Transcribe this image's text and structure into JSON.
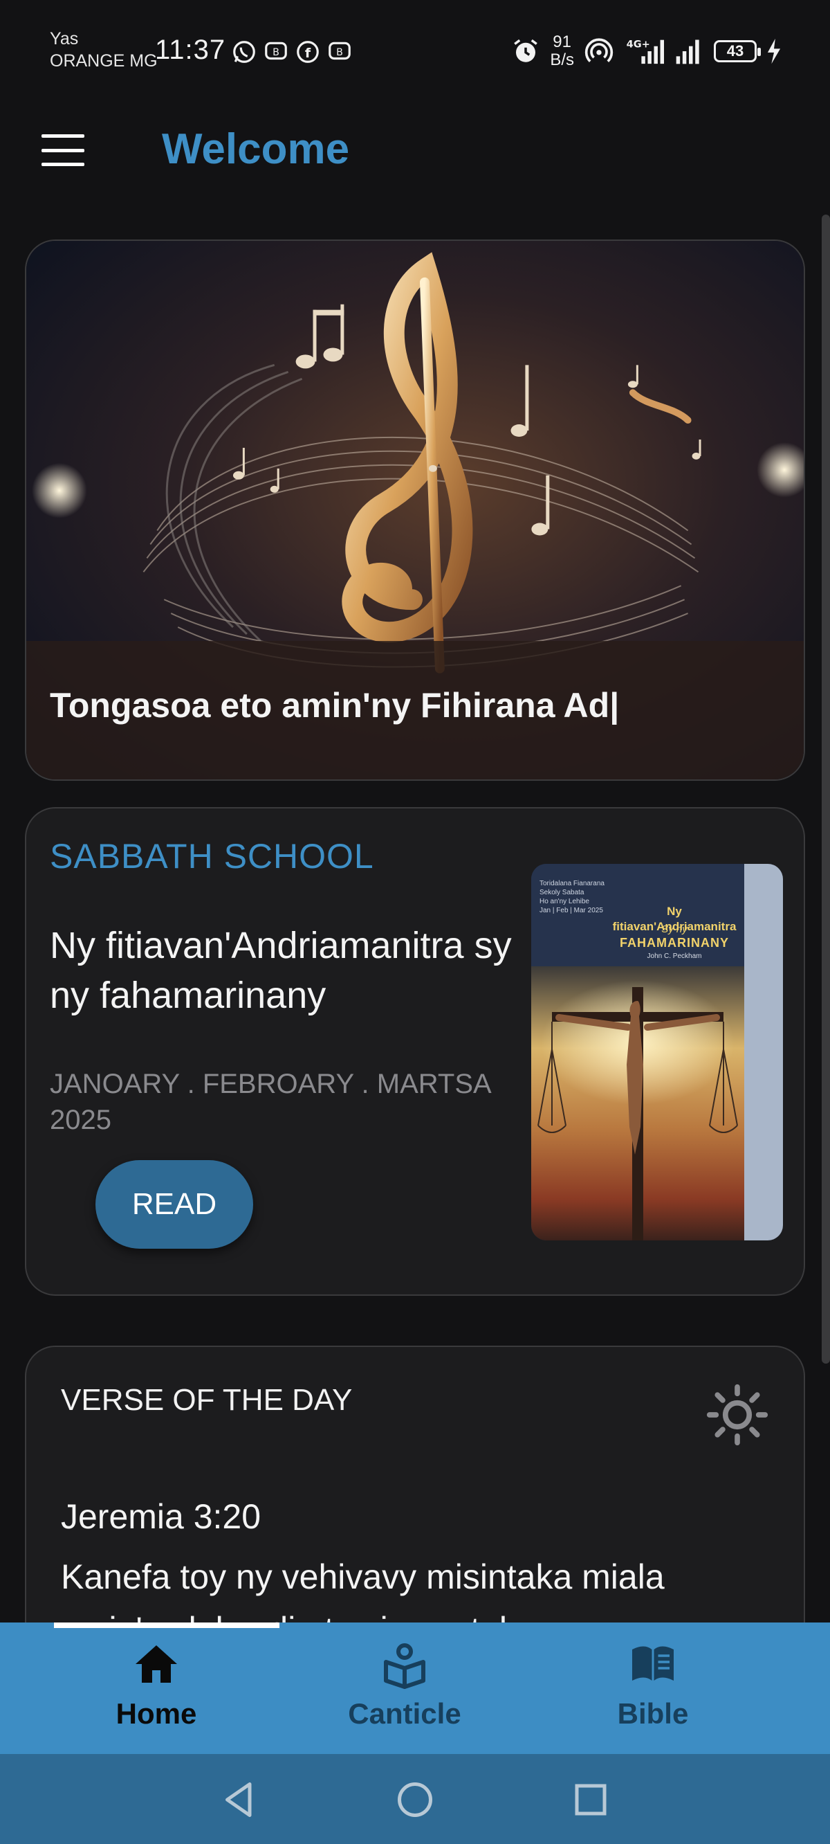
{
  "status_bar": {
    "carrier_line1": "Yas",
    "carrier_line2": "ORANGE MG",
    "time": "11:37",
    "net_speed_value": "91",
    "net_speed_unit": "B/s",
    "battery": "43",
    "icons": [
      "whatsapp-icon",
      "whatsapp-business-icon",
      "facebook-icon",
      "whatsapp-business-icon",
      "alarm-icon",
      "hotspot-icon",
      "signal-4g-icon",
      "signal-icon",
      "battery-icon",
      "charging-icon"
    ]
  },
  "header": {
    "title": "Welcome",
    "menu_icon": "hamburger-menu-icon"
  },
  "hero": {
    "caption": "Tongasoa eto amin'ny Fihirana Ad|"
  },
  "sabbath_school": {
    "label": "SABBATH SCHOOL",
    "title": "Ny fitiavan'Andriamanitra sy ny fahamarinany",
    "date": "JANOARY . FEBROARY . MARTSA 2025",
    "read_label": "READ",
    "cover": {
      "small_text_1": "Toridalana Fianarana",
      "small_text_2": "Sekoly Sabata",
      "small_text_3": "Ho an'ny Lehibe",
      "small_text_4": "Jan | Feb | Mar 2025",
      "title": "Ny fitiavan'Andriamanitra",
      "sub": "Sy ny",
      "big": "FAHAMARINANY",
      "author": "John C. Peckham"
    }
  },
  "verse_of_day": {
    "label": "VERSE OF THE DAY",
    "reference": "Jeremia 3:20",
    "text": " Kanefa toy ny vehivavy misintaka miala amin'ny lahy, dia toy izany tokoa",
    "theme_icon": "sun-icon"
  },
  "bottom_nav": {
    "items": [
      {
        "label": "Home",
        "icon": "home-icon",
        "active": true
      },
      {
        "label": "Canticle",
        "icon": "hymnal-icon",
        "active": false
      },
      {
        "label": "Bible",
        "icon": "open-book-icon",
        "active": false
      }
    ]
  },
  "colors": {
    "accent": "#3e8fc6",
    "background": "#121214",
    "card": "#1c1c1e",
    "read_button": "#2e6a94",
    "nav_bar": "#3d8dc4",
    "system_nav": "#2e6a94"
  }
}
